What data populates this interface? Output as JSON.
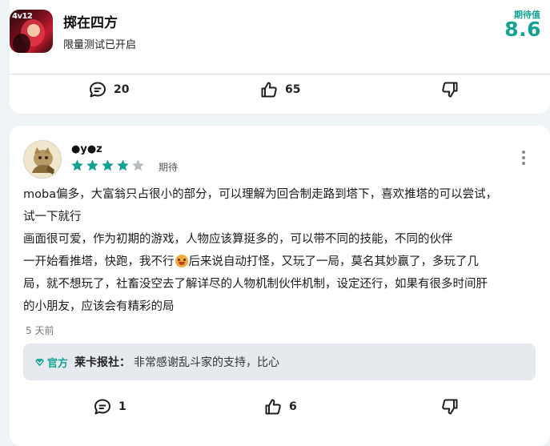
{
  "game": {
    "title": "掷在四方",
    "status": "限量测试已开启",
    "icon_tag": "4v12",
    "expect_label": "期待值",
    "expect_score": "8.6"
  },
  "top_actions": {
    "comment_count": "20",
    "like_count": "65"
  },
  "review": {
    "user_name": "●y●z",
    "stars_filled": 4,
    "stars_total": 5,
    "rating_label": "期待",
    "body_lines": [
      "moba偏多，大富翁只占很小的部分，可以理解为回合制走路到塔下，喜欢推塔的可以尝试，",
      "试一下就行",
      "画面很可爱，作为初期的游戏，人物应该算挺多的，可以带不同的技能，不同的伙伴",
      "一开始看推塔，快跑，我不行",
      "后来说自动打怪，又玩了一局，莫名其妙赢了，多玩了几",
      "局，就不想玩了，社畜没空去了解详尽的人物机制伙伴机制，设定还行，如果有很多时间肝",
      "的小朋友，应该会有精彩的局"
    ],
    "time_ago": "5 天前",
    "reply": {
      "official_label": "官方",
      "author": "莱卡报社：",
      "text": "非常感谢乱斗家的支持，比心"
    },
    "actions": {
      "comment_count": "1",
      "like_count": "6"
    }
  },
  "colors": {
    "accent": "#14a392",
    "star_filled": "#14a392",
    "star_empty": "#b7bcc2",
    "background": "#eef3f6"
  },
  "icons": [
    "comment-icon",
    "thumbs-up-icon",
    "thumbs-down-icon",
    "more-vertical-icon",
    "verified-icon",
    "grinning-emoji-icon"
  ]
}
